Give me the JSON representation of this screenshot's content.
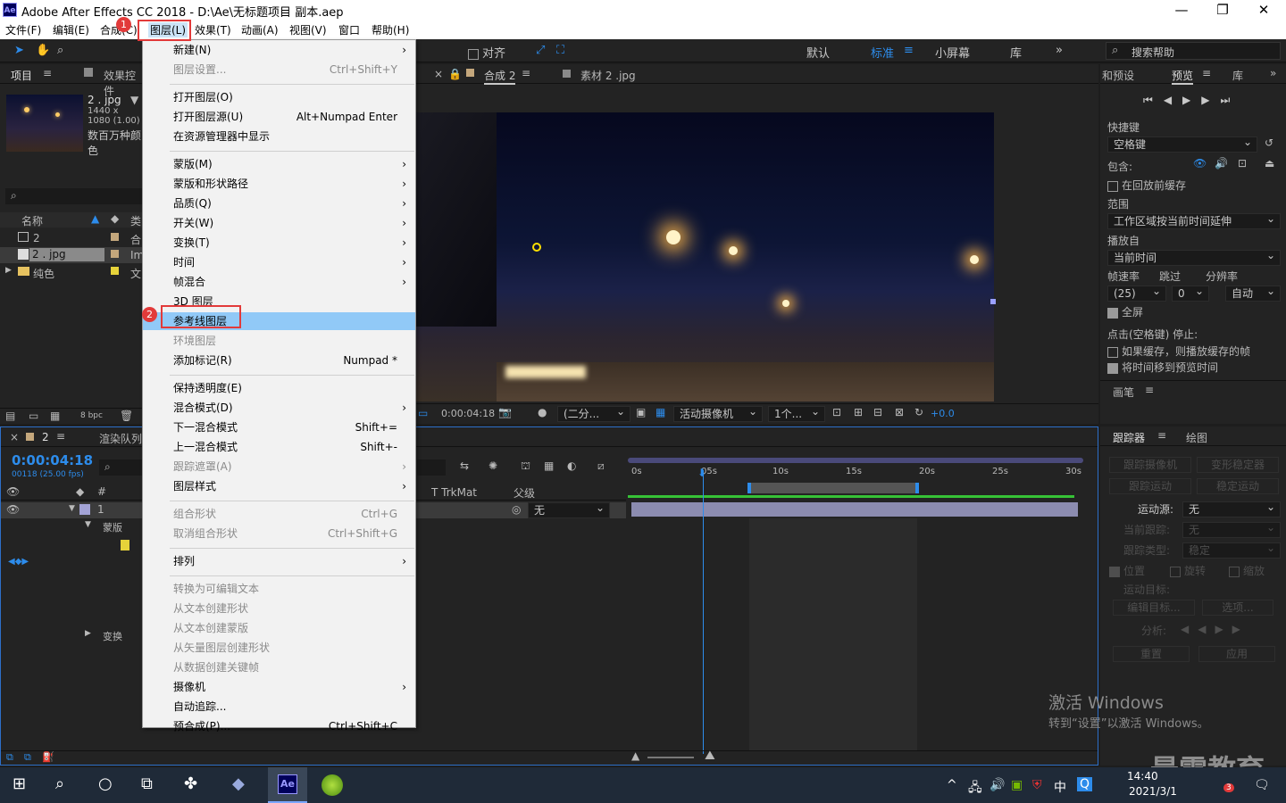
{
  "window": {
    "title": "Adobe After Effects CC 2018 - D:\\Ae\\无标题项目 副本.aep",
    "logo": "Ae"
  },
  "menubar": [
    "文件(F)",
    "编辑(E)",
    "合成(C)",
    "图层(L)",
    "效果(T)",
    "动画(A)",
    "视图(V)",
    "窗口",
    "帮助(H)"
  ],
  "toolbar": {
    "align_label": "对齐",
    "workspaces": [
      "默认",
      "标准",
      "小屏幕",
      "库"
    ],
    "search_placeholder": "搜索帮助"
  },
  "project": {
    "tab": "项目",
    "effects_tab": "效果控件",
    "file_name": "2 . jpg",
    "file_dims": "1440 x 1080 (1.00)",
    "file_desc": "数百万种颜色",
    "col_name": "名称",
    "col_type": "类",
    "items": [
      {
        "name": "2",
        "type": "合"
      },
      {
        "name": "2 . jpg",
        "type": "Im"
      },
      {
        "name": "纯色",
        "type": "文"
      }
    ],
    "bpc": "8 bpc"
  },
  "composition": {
    "tabs": [
      "合成 2",
      "素材 2 .jpg"
    ],
    "timecode": "0:00:04:18",
    "resolution": "(二分...",
    "camera": "活动摄像机",
    "views": "1个...",
    "exposure": "+0.0"
  },
  "preview": {
    "tabs": [
      "和预设",
      "预览",
      "库"
    ],
    "shortcut_label": "快捷键",
    "shortcut_value": "空格键",
    "include_label": "包含:",
    "cache_before": "在回放前缓存",
    "range_label": "范围",
    "range_value": "工作区域按当前时间延伸",
    "play_from_label": "播放自",
    "play_from_value": "当前时间",
    "fps_label": "帧速率",
    "skip_label": "跳过",
    "res_label": "分辨率",
    "fps_value": "(25)",
    "skip_value": "0",
    "res_value": "自动",
    "fullscreen": "全屏",
    "stop_label": "点击(空格键) 停止:",
    "if_cache": "如果缓存，则播放缓存的帧",
    "move_time": "将时间移到预览时间",
    "brush_tab": "画笔"
  },
  "tracker": {
    "tabs": [
      "跟踪器",
      "绘图"
    ],
    "track_camera": "跟踪摄像机",
    "warp_stabilizer": "变形稳定器",
    "track_motion": "跟踪运动",
    "stabilize_motion": "稳定运动",
    "motion_source_label": "运动源:",
    "motion_source_value": "无",
    "current_track_label": "当前跟踪:",
    "current_track_value": "无",
    "track_type_label": "跟踪类型:",
    "track_type_value": "稳定",
    "position": "位置",
    "rotation": "旋转",
    "scale": "缩放",
    "motion_target": "运动目标:",
    "edit_target": "编辑目标...",
    "options": "选项...",
    "analyze": "分析:",
    "reset": "重置",
    "apply": "应用"
  },
  "timeline": {
    "comp_tab": "2",
    "render_tab": "渲染队列",
    "timecode": "0:00:04:18",
    "frames": "00118 (25.00 fps)",
    "col_trkmat": "T  TrkMat",
    "col_parent": "父级",
    "parent_value": "无",
    "layer_num": "1",
    "mask_label": "蒙版",
    "transform_label": "变换",
    "ruler": [
      "0s",
      "05s",
      "10s",
      "15s",
      "20s",
      "25s",
      "30s"
    ]
  },
  "layer_menu": {
    "items": [
      {
        "label": "新建(N)",
        "shortcut": "",
        "arrow": true,
        "disabled": false
      },
      {
        "label": "图层设置...",
        "shortcut": "Ctrl+Shift+Y",
        "arrow": false,
        "disabled": true
      },
      {
        "sep": true
      },
      {
        "label": "打开图层(O)",
        "shortcut": "",
        "arrow": false,
        "disabled": false
      },
      {
        "label": "打开图层源(U)",
        "shortcut": "Alt+Numpad Enter",
        "arrow": false,
        "disabled": false
      },
      {
        "label": "在资源管理器中显示",
        "shortcut": "",
        "arrow": false,
        "disabled": false
      },
      {
        "sep": true
      },
      {
        "label": "蒙版(M)",
        "shortcut": "",
        "arrow": true,
        "disabled": false
      },
      {
        "label": "蒙版和形状路径",
        "shortcut": "",
        "arrow": true,
        "disabled": false
      },
      {
        "label": "品质(Q)",
        "shortcut": "",
        "arrow": true,
        "disabled": false
      },
      {
        "label": "开关(W)",
        "shortcut": "",
        "arrow": true,
        "disabled": false
      },
      {
        "label": "变换(T)",
        "shortcut": "",
        "arrow": true,
        "disabled": false
      },
      {
        "label": "时间",
        "shortcut": "",
        "arrow": true,
        "disabled": false
      },
      {
        "label": "帧混合",
        "shortcut": "",
        "arrow": true,
        "disabled": false
      },
      {
        "label": "3D 图层",
        "shortcut": "",
        "arrow": false,
        "disabled": false
      },
      {
        "label": "参考线图层",
        "shortcut": "",
        "arrow": false,
        "disabled": false,
        "highlight": true
      },
      {
        "label": "环境图层",
        "shortcut": "",
        "arrow": false,
        "disabled": true
      },
      {
        "label": "添加标记(R)",
        "shortcut": "Numpad *",
        "arrow": false,
        "disabled": false
      },
      {
        "sep": true
      },
      {
        "label": "保持透明度(E)",
        "shortcut": "",
        "arrow": false,
        "disabled": false
      },
      {
        "label": "混合模式(D)",
        "shortcut": "",
        "arrow": true,
        "disabled": false
      },
      {
        "label": "下一混合模式",
        "shortcut": "Shift+=",
        "arrow": false,
        "disabled": false
      },
      {
        "label": "上一混合模式",
        "shortcut": "Shift+-",
        "arrow": false,
        "disabled": false
      },
      {
        "label": "跟踪遮罩(A)",
        "shortcut": "",
        "arrow": true,
        "disabled": true
      },
      {
        "label": "图层样式",
        "shortcut": "",
        "arrow": true,
        "disabled": false
      },
      {
        "sep": true
      },
      {
        "label": "组合形状",
        "shortcut": "Ctrl+G",
        "arrow": false,
        "disabled": true
      },
      {
        "label": "取消组合形状",
        "shortcut": "Ctrl+Shift+G",
        "arrow": false,
        "disabled": true
      },
      {
        "sep": true
      },
      {
        "label": "排列",
        "shortcut": "",
        "arrow": true,
        "disabled": false
      },
      {
        "sep": true
      },
      {
        "label": "转换为可编辑文本",
        "shortcut": "",
        "arrow": false,
        "disabled": true
      },
      {
        "label": "从文本创建形状",
        "shortcut": "",
        "arrow": false,
        "disabled": true
      },
      {
        "label": "从文本创建蒙版",
        "shortcut": "",
        "arrow": false,
        "disabled": true
      },
      {
        "label": "从矢量图层创建形状",
        "shortcut": "",
        "arrow": false,
        "disabled": true
      },
      {
        "label": "从数据创建关键帧",
        "shortcut": "",
        "arrow": false,
        "disabled": true
      },
      {
        "label": "摄像机",
        "shortcut": "",
        "arrow": true,
        "disabled": false
      },
      {
        "label": "自动追踪...",
        "shortcut": "",
        "arrow": false,
        "disabled": false
      },
      {
        "label": "预合成(P)...",
        "shortcut": "Ctrl+Shift+C",
        "arrow": false,
        "disabled": false
      }
    ]
  },
  "annotations": {
    "step1": "1",
    "step2": "2"
  },
  "watermark": {
    "activate_title": "激活 Windows",
    "activate_sub": "转到“设置”以激活 Windows。",
    "brand": "最需教育"
  },
  "taskbar": {
    "time": "14:40",
    "date": "2021/3/1",
    "ime": "中",
    "notif_count": "3"
  }
}
